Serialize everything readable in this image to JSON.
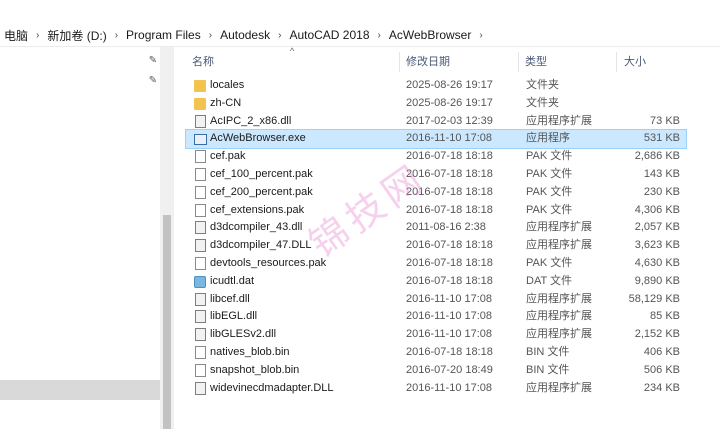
{
  "breadcrumb": {
    "items": [
      "电脑",
      "新加卷 (D:)",
      "Program Files",
      "Autodesk",
      "AutoCAD 2018",
      "AcWebBrowser"
    ]
  },
  "columns": {
    "name": "名称",
    "date": "修改日期",
    "type": "类型",
    "size": "大小"
  },
  "files": [
    {
      "name": "locales",
      "date": "2025-08-26 19:17",
      "type": "文件夹",
      "size": "",
      "icon": "folder-icon"
    },
    {
      "name": "zh-CN",
      "date": "2025-08-26 19:17",
      "type": "文件夹",
      "size": "",
      "icon": "folder-icon"
    },
    {
      "name": "AcIPC_2_x86.dll",
      "date": "2017-02-03 12:39",
      "type": "应用程序扩展",
      "size": "73 KB",
      "icon": "dll-icon"
    },
    {
      "name": "AcWebBrowser.exe",
      "date": "2016-11-10 17:08",
      "type": "应用程序",
      "size": "531 KB",
      "icon": "exe-icon"
    },
    {
      "name": "cef.pak",
      "date": "2016-07-18 18:18",
      "type": "PAK 文件",
      "size": "2,686 KB",
      "icon": "doc-icon"
    },
    {
      "name": "cef_100_percent.pak",
      "date": "2016-07-18 18:18",
      "type": "PAK 文件",
      "size": "143 KB",
      "icon": "doc-icon"
    },
    {
      "name": "cef_200_percent.pak",
      "date": "2016-07-18 18:18",
      "type": "PAK 文件",
      "size": "230 KB",
      "icon": "doc-icon"
    },
    {
      "name": "cef_extensions.pak",
      "date": "2016-07-18 18:18",
      "type": "PAK 文件",
      "size": "4,306 KB",
      "icon": "doc-icon"
    },
    {
      "name": "d3dcompiler_43.dll",
      "date": "2011-08-16 2:38",
      "type": "应用程序扩展",
      "size": "2,057 KB",
      "icon": "dll-icon"
    },
    {
      "name": "d3dcompiler_47.DLL",
      "date": "2016-07-18 18:18",
      "type": "应用程序扩展",
      "size": "3,623 KB",
      "icon": "dll-icon"
    },
    {
      "name": "devtools_resources.pak",
      "date": "2016-07-18 18:18",
      "type": "PAK 文件",
      "size": "4,630 KB",
      "icon": "doc-icon"
    },
    {
      "name": "icudtl.dat",
      "date": "2016-07-18 18:18",
      "type": "DAT 文件",
      "size": "9,890 KB",
      "icon": "dat-icon"
    },
    {
      "name": "libcef.dll",
      "date": "2016-11-10 17:08",
      "type": "应用程序扩展",
      "size": "58,129 KB",
      "icon": "dll-icon"
    },
    {
      "name": "libEGL.dll",
      "date": "2016-11-10 17:08",
      "type": "应用程序扩展",
      "size": "85 KB",
      "icon": "dll-icon"
    },
    {
      "name": "libGLESv2.dll",
      "date": "2016-11-10 17:08",
      "type": "应用程序扩展",
      "size": "2,152 KB",
      "icon": "dll-icon"
    },
    {
      "name": "natives_blob.bin",
      "date": "2016-07-18 18:18",
      "type": "BIN 文件",
      "size": "406 KB",
      "icon": "doc-icon"
    },
    {
      "name": "snapshot_blob.bin",
      "date": "2016-07-20 18:49",
      "type": "BIN 文件",
      "size": "506 KB",
      "icon": "doc-icon"
    },
    {
      "name": "widevinecdmadapter.DLL",
      "date": "2016-11-10 17:08",
      "type": "应用程序扩展",
      "size": "234 KB",
      "icon": "dll-icon"
    }
  ],
  "selected_index": 3,
  "watermark": "锦技网"
}
